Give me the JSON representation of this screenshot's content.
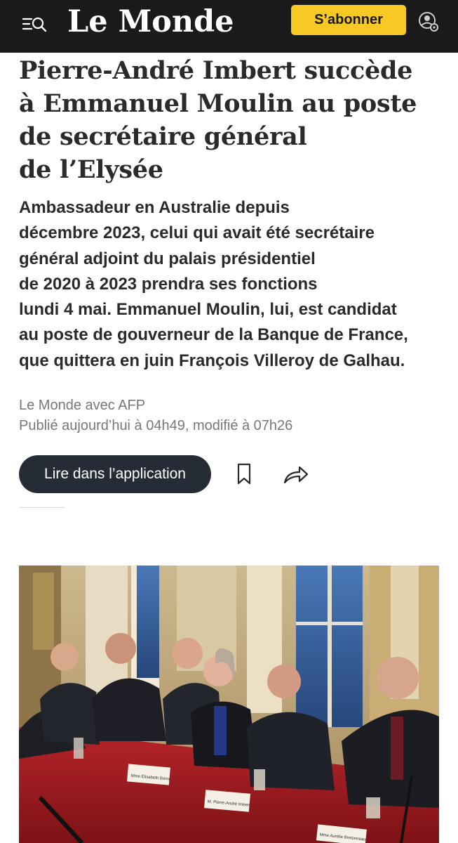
{
  "header": {
    "logo_text": "Le Monde",
    "subscribe_label": "S’abonner",
    "menu_icon": "menu-search-icon",
    "account_icon": "account-settings-icon",
    "background_color": "#1a1a1a",
    "accent_color": "#f7c924"
  },
  "article": {
    "title_lines": [
      "Pierre-André Imbert succède",
      "à Emmanuel Moulin au poste",
      "de secrétaire général",
      "de l’Elysée"
    ],
    "lead_lines": [
      "Ambassadeur en Australie depuis",
      "décembre 2023, celui qui avait été secrétaire",
      "général adjoint du palais présidentiel",
      "de 2020 à 2023 prendra ses fonctions",
      "lundi 4 mai. Emmanuel Moulin, lui, est candidat",
      "au poste de gouverneur de la Banque de France,",
      "que quittera en juin François Villeroy de Galhau."
    ],
    "source": "Le Monde avec AFP",
    "published": "Publié aujourd’hui à 04h49, modifié à 07h26"
  },
  "actions": {
    "read_in_app_label": "Lire dans l’application",
    "bookmark_icon": "bookmark-icon",
    "share_icon": "share-icon",
    "button_color": "#262c35"
  },
  "photo": {
    "place_cards": [
      "Mme Élisabeth Borne",
      "M. Pierre-André Imbert",
      "Mme Aurélie Bretonneau"
    ]
  }
}
